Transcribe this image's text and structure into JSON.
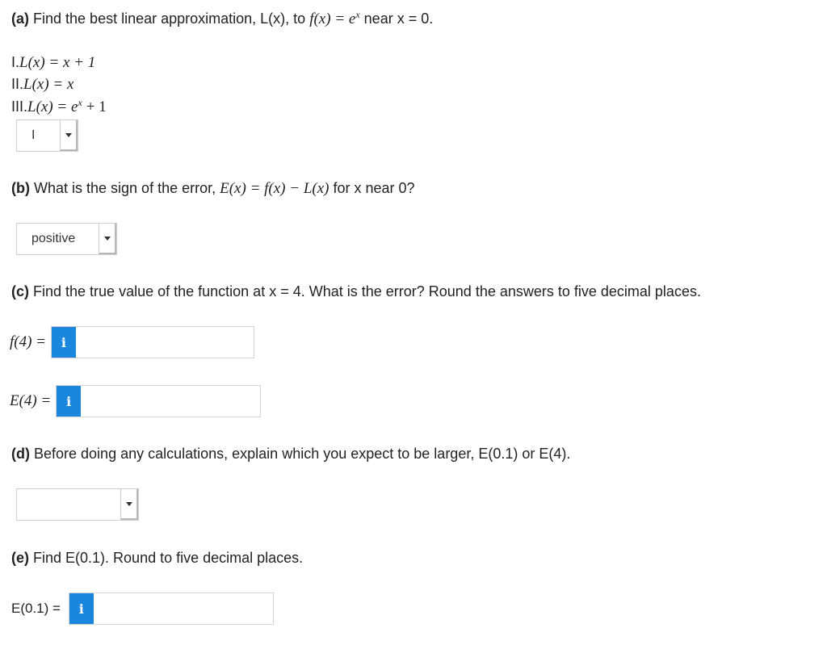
{
  "part_a": {
    "label": "(a)",
    "text_pre": "Find the best linear approximation, L(x), to",
    "func": "f(x) = e",
    "func_exp": "x",
    "text_post": "near x = 0.",
    "options": [
      {
        "num": "I.",
        "expr": "L(x) = x + 1"
      },
      {
        "num": "II.",
        "expr": "L(x) = x"
      },
      {
        "num": "III.",
        "expr": "L(x) = e",
        "exp": "x",
        "tail": "+ 1"
      }
    ],
    "select_value": "I"
  },
  "part_b": {
    "label": "(b)",
    "text_pre": "What is the sign of the error,",
    "expr": "E(x) = f(x) − L(x)",
    "text_post": "for x near 0?",
    "select_value": "positive"
  },
  "part_c": {
    "label": "(c)",
    "text": "Find the true value of the function at x = 4. What is the error? Round the answers to five decimal places.",
    "f_label": "f(4) =",
    "e_label": "E(4) =",
    "f_value": "",
    "e_value": ""
  },
  "part_d": {
    "label": "(d)",
    "text": "Before doing any calculations, explain which you expect to be larger, E(0.1) or E(4).",
    "select_value": ""
  },
  "part_e": {
    "label": "(e)",
    "text": "Find E(0.1). Round to five decimal places.",
    "e_label": "E(0.1) =",
    "e_value": ""
  },
  "info_icon": "i",
  "colors": {
    "info_bg": "#1a86dd",
    "text": "#222222",
    "border": "#d4d4d4"
  }
}
